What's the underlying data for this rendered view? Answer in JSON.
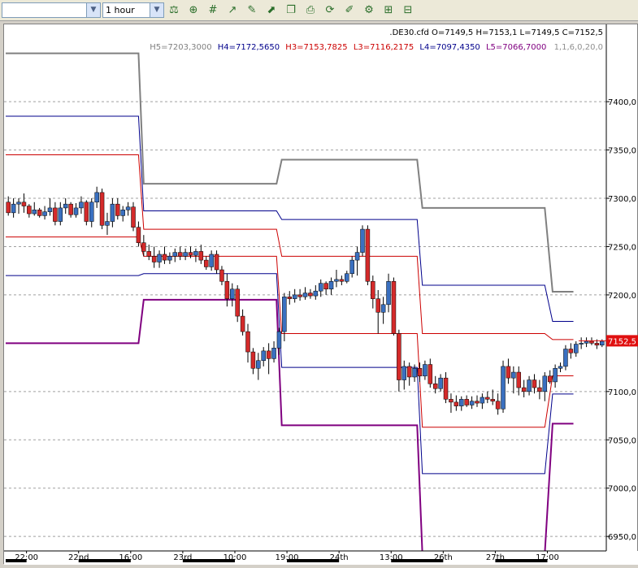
{
  "toolbar": {
    "symbol_value": "",
    "timeframe_value": "1 hour",
    "icons": [
      "add-study-icon",
      "add-indicator-icon",
      "grid-icon",
      "line-chart-icon",
      "draw-icon",
      "trend-icon",
      "copy-icon",
      "print-icon",
      "refresh-icon",
      "edit-icon",
      "settings-icon",
      "zoom-in-icon",
      "zoom-out-icon"
    ]
  },
  "chart_data": {
    "type": "candlestick",
    "title": ".DE30.cfd O=7149,5 H=7153,1 L=7149,5 C=7152,5",
    "indicator_label": {
      "h5": "H5=7203,3000",
      "h4": "H4=7172,5650",
      "h3": "H3=7153,7825",
      "l3": "L3=7116,2175",
      "l4": "L4=7097,4350",
      "l5": "L5=7066,7000",
      "params": "1,1,6,0,20,0"
    },
    "current_price_label": "7152,5",
    "current_price": 7152.5,
    "ylim": [
      6935,
      7480
    ],
    "y_ticks": [
      {
        "value": 7400,
        "label": "7400,0"
      },
      {
        "value": 7350,
        "label": "7350,0"
      },
      {
        "value": 7300,
        "label": "7300,0"
      },
      {
        "value": 7250,
        "label": "7250,0"
      },
      {
        "value": 7200,
        "label": "7200,0"
      },
      {
        "value": 7100,
        "label": "7100,0"
      },
      {
        "value": 7050,
        "label": "7050,0"
      },
      {
        "value": 7000,
        "label": "7000,0"
      },
      {
        "value": 6950,
        "label": "6950,0"
      }
    ],
    "x_range": [
      0,
      115
    ],
    "x_ticks": [
      {
        "i": 4,
        "label": "22:00"
      },
      {
        "i": 14,
        "label": "22nd"
      },
      {
        "i": 24,
        "label": "16:00"
      },
      {
        "i": 34,
        "label": "23rd"
      },
      {
        "i": 44,
        "label": "10:00"
      },
      {
        "i": 54,
        "label": "19:00"
      },
      {
        "i": 64,
        "label": "24th"
      },
      {
        "i": 74,
        "label": "13:00"
      },
      {
        "i": 84,
        "label": "26th"
      },
      {
        "i": 94,
        "label": "27th"
      },
      {
        "i": 104,
        "label": "17:00"
      }
    ],
    "pivot_colors": {
      "h5": "#808080",
      "h4": "#00008b",
      "h3": "#cc0000",
      "l3": "#cc0000",
      "l4": "#00008b",
      "l5": "#800080"
    },
    "pivot_segments": [
      {
        "x0": 0,
        "x1": 25.5,
        "h5": 7450,
        "h4": 7385,
        "h3": 7345,
        "l3": 7260,
        "l4": 7220,
        "l5": 7150
      },
      {
        "x0": 26.5,
        "x1": 52,
        "h5": 7315,
        "h4": 7287,
        "h3": 7268,
        "l3": 7240,
        "l4": 7222,
        "l5": 7195
      },
      {
        "x0": 53,
        "x1": 79,
        "h5": 7340,
        "h4": 7278,
        "h3": 7240,
        "l3": 7160,
        "l4": 7125,
        "l5": 7065
      },
      {
        "x0": 80,
        "x1": 103.5,
        "h5": 7290,
        "h4": 7210,
        "h3": 7160,
        "l3": 7063,
        "l4": 7015,
        "l5": 6932
      },
      {
        "x0": 105,
        "x1": 109,
        "h5": 7203.3,
        "h4": 7172.565,
        "h3": 7153.7825,
        "l3": 7116.2175,
        "l4": 7097.435,
        "l5": 7066.7
      }
    ],
    "ohlc": [
      [
        7296,
        7302,
        7282,
        7285
      ],
      [
        7285,
        7300,
        7280,
        7294
      ],
      [
        7294,
        7300,
        7284,
        7296
      ],
      [
        7296,
        7305,
        7285,
        7292
      ],
      [
        7292,
        7294,
        7280,
        7284
      ],
      [
        7284,
        7296,
        7282,
        7288
      ],
      [
        7288,
        7290,
        7280,
        7282
      ],
      [
        7282,
        7292,
        7278,
        7286
      ],
      [
        7286,
        7300,
        7282,
        7290
      ],
      [
        7290,
        7296,
        7272,
        7276
      ],
      [
        7276,
        7296,
        7272,
        7290
      ],
      [
        7290,
        7300,
        7284,
        7294
      ],
      [
        7294,
        7296,
        7280,
        7283
      ],
      [
        7283,
        7295,
        7280,
        7290
      ],
      [
        7290,
        7302,
        7284,
        7296
      ],
      [
        7296,
        7298,
        7272,
        7276
      ],
      [
        7276,
        7300,
        7270,
        7296
      ],
      [
        7296,
        7312,
        7290,
        7306
      ],
      [
        7306,
        7310,
        7268,
        7272
      ],
      [
        7272,
        7285,
        7262,
        7276
      ],
      [
        7276,
        7300,
        7270,
        7294
      ],
      [
        7294,
        7300,
        7278,
        7282
      ],
      [
        7282,
        7292,
        7276,
        7288
      ],
      [
        7288,
        7296,
        7282,
        7291
      ],
      [
        7291,
        7296,
        7266,
        7270
      ],
      [
        7270,
        7276,
        7250,
        7254
      ],
      [
        7254,
        7262,
        7240,
        7245
      ],
      [
        7245,
        7252,
        7236,
        7240
      ],
      [
        7240,
        7250,
        7228,
        7234
      ],
      [
        7234,
        7246,
        7228,
        7242
      ],
      [
        7242,
        7250,
        7232,
        7236
      ],
      [
        7236,
        7244,
        7232,
        7240
      ],
      [
        7240,
        7248,
        7234,
        7244
      ],
      [
        7244,
        7250,
        7236,
        7240
      ],
      [
        7240,
        7248,
        7236,
        7244
      ],
      [
        7244,
        7250,
        7238,
        7241
      ],
      [
        7241,
        7248,
        7234,
        7245
      ],
      [
        7245,
        7252,
        7232,
        7236
      ],
      [
        7236,
        7240,
        7226,
        7229
      ],
      [
        7229,
        7246,
        7225,
        7242
      ],
      [
        7242,
        7246,
        7222,
        7226
      ],
      [
        7226,
        7230,
        7210,
        7214
      ],
      [
        7214,
        7222,
        7188,
        7196
      ],
      [
        7196,
        7212,
        7188,
        7206
      ],
      [
        7206,
        7210,
        7172,
        7178
      ],
      [
        7178,
        7185,
        7158,
        7162
      ],
      [
        7162,
        7170,
        7130,
        7141
      ],
      [
        7141,
        7145,
        7118,
        7124
      ],
      [
        7124,
        7140,
        7112,
        7132
      ],
      [
        7132,
        7146,
        7126,
        7142
      ],
      [
        7142,
        7150,
        7118,
        7134
      ],
      [
        7134,
        7152,
        7130,
        7145
      ],
      [
        7145,
        7166,
        7138,
        7162
      ],
      [
        7162,
        7202,
        7152,
        7198
      ],
      [
        7198,
        7204,
        7190,
        7196
      ],
      [
        7196,
        7206,
        7192,
        7200
      ],
      [
        7200,
        7206,
        7194,
        7198
      ],
      [
        7198,
        7208,
        7195,
        7202
      ],
      [
        7202,
        7206,
        7196,
        7199
      ],
      [
        7199,
        7210,
        7195,
        7204
      ],
      [
        7204,
        7216,
        7198,
        7212
      ],
      [
        7212,
        7214,
        7200,
        7206
      ],
      [
        7206,
        7218,
        7200,
        7214
      ],
      [
        7214,
        7226,
        7208,
        7216
      ],
      [
        7216,
        7220,
        7210,
        7214
      ],
      [
        7214,
        7225,
        7212,
        7222
      ],
      [
        7222,
        7240,
        7218,
        7236
      ],
      [
        7236,
        7250,
        7220,
        7244
      ],
      [
        7244,
        7272,
        7240,
        7268
      ],
      [
        7268,
        7272,
        7210,
        7214
      ],
      [
        7214,
        7220,
        7186,
        7196
      ],
      [
        7196,
        7205,
        7160,
        7182
      ],
      [
        7182,
        7198,
        7170,
        7190
      ],
      [
        7190,
        7222,
        7182,
        7214
      ],
      [
        7214,
        7218,
        7158,
        7160
      ],
      [
        7160,
        7164,
        7100,
        7112
      ],
      [
        7112,
        7132,
        7102,
        7126
      ],
      [
        7126,
        7130,
        7106,
        7115
      ],
      [
        7115,
        7128,
        7110,
        7124
      ],
      [
        7124,
        7130,
        7110,
        7116
      ],
      [
        7116,
        7132,
        7112,
        7128
      ],
      [
        7128,
        7134,
        7104,
        7108
      ],
      [
        7108,
        7116,
        7098,
        7103
      ],
      [
        7103,
        7118,
        7100,
        7114
      ],
      [
        7114,
        7120,
        7088,
        7092
      ],
      [
        7092,
        7098,
        7078,
        7089
      ],
      [
        7089,
        7096,
        7080,
        7085
      ],
      [
        7085,
        7095,
        7080,
        7092
      ],
      [
        7092,
        7096,
        7084,
        7086
      ],
      [
        7086,
        7095,
        7082,
        7090
      ],
      [
        7090,
        7096,
        7084,
        7088
      ],
      [
        7088,
        7098,
        7082,
        7094
      ],
      [
        7094,
        7100,
        7088,
        7092
      ],
      [
        7092,
        7102,
        7086,
        7090
      ],
      [
        7090,
        7098,
        7076,
        7082
      ],
      [
        7082,
        7132,
        7078,
        7126
      ],
      [
        7126,
        7134,
        7108,
        7114
      ],
      [
        7114,
        7126,
        7098,
        7120
      ],
      [
        7120,
        7126,
        7096,
        7104
      ],
      [
        7104,
        7112,
        7094,
        7100
      ],
      [
        7100,
        7116,
        7096,
        7112
      ],
      [
        7112,
        7118,
        7098,
        7104
      ],
      [
        7104,
        7112,
        7092,
        7100
      ],
      [
        7100,
        7120,
        7090,
        7116
      ],
      [
        7116,
        7122,
        7108,
        7110
      ],
      [
        7110,
        7128,
        7104,
        7124
      ],
      [
        7124,
        7130,
        7120,
        7126
      ],
      [
        7126,
        7148,
        7122,
        7144
      ],
      [
        7144,
        7150,
        7134,
        7140
      ],
      [
        7140,
        7152,
        7136,
        7149
      ],
      [
        7149,
        7156,
        7144,
        7150
      ],
      [
        7150,
        7156,
        7146,
        7152
      ],
      [
        7152,
        7156,
        7148,
        7150
      ],
      [
        7150,
        7154,
        7144,
        7148
      ],
      [
        7148,
        7154,
        7146,
        7152
      ]
    ]
  },
  "colors": {
    "up": "#3a70c0",
    "down": "#d42a2a",
    "grid": "#a0a0a0",
    "price_tag": "#e01010"
  }
}
